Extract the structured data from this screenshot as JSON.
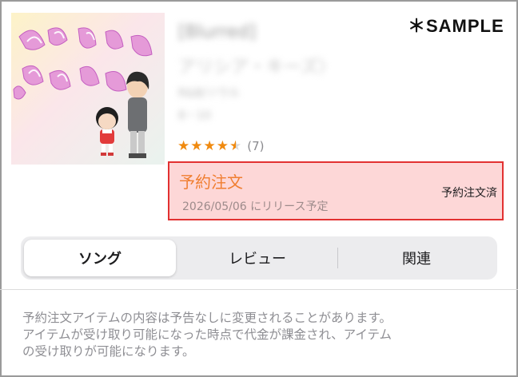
{
  "watermark": "＊SAMPLE",
  "album": {
    "title": "[Blurred]",
    "artist": "アリシア・キーズ〉",
    "meta_line1": "R&B/ソウル",
    "meta_line2": "8・10",
    "rating_stars": 4.5,
    "rating_count": "(7)"
  },
  "preorder": {
    "title": "予約注文",
    "release_text": "2026/05/06 にリリース予定",
    "status": "予約注文済"
  },
  "tabs": [
    {
      "label": "ソング",
      "selected": true
    },
    {
      "label": "レビュー",
      "selected": false
    },
    {
      "label": "関連",
      "selected": false
    }
  ],
  "notice": {
    "line1": "予約注文アイテムの内容は予告なしに変更されることがあります。",
    "line2": "アイテムが受け取り可能になった時点で代金が課金され、アイテム",
    "line3": "の受け取りが可能になります。"
  },
  "colors": {
    "accent_orange": "#f08a0f",
    "preorder_bg": "#fdd7d7",
    "preorder_border": "#e23131"
  }
}
